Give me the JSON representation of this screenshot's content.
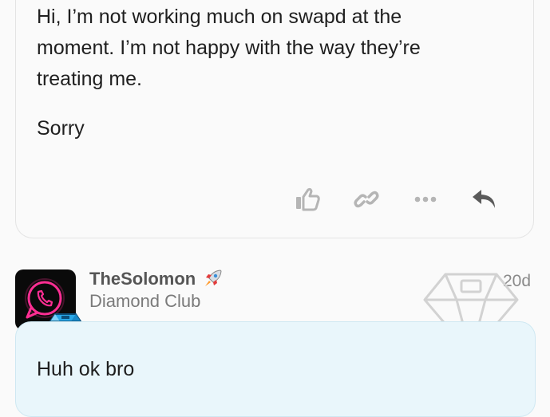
{
  "post1": {
    "body": "Hi, I’m not working much on swapd at the\nmoment. I’m not happy with the way they’re\ntreating me.",
    "signoff": "Sorry",
    "actions": {
      "like_icon": "thumbs-up-icon",
      "link_icon": "link-icon",
      "more_icon": "more-dots-icon",
      "reply_icon": "reply-arrow-icon"
    }
  },
  "post2": {
    "username": "TheSolomon",
    "user_badge_icon": "rocket-icon",
    "user_title": "Diamond Club",
    "date": "20d",
    "body": "Huh ok bro",
    "avatar_icon": "whatsapp-neon-icon",
    "flair_icon": "diamond-icon"
  },
  "colors": {
    "background": "#fafafa",
    "reply_card": "#e9f6fb",
    "username": "#555555",
    "neon_pink": "#ff2e93",
    "diamond_blue": "#29a8e8"
  }
}
